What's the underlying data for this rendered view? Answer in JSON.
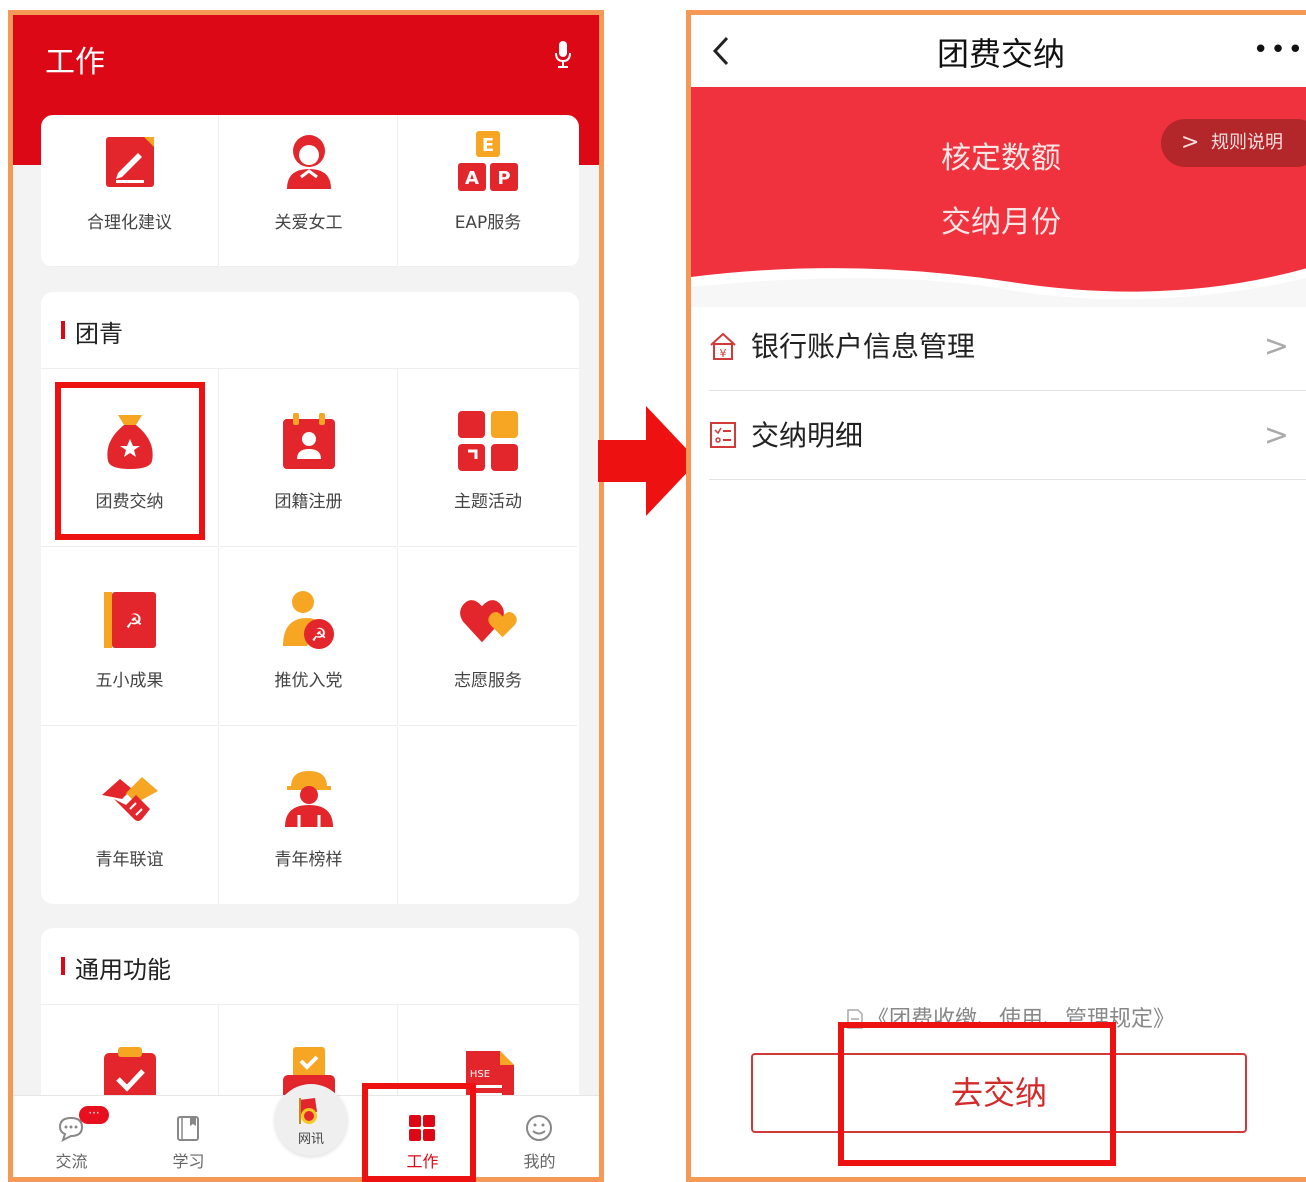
{
  "left_screen": {
    "header_title": "工作",
    "top_items": [
      {
        "label": "合理化建议",
        "icon": "edit-icon"
      },
      {
        "label": "关爱女工",
        "icon": "woman-worker-icon"
      },
      {
        "label": "EAP服务",
        "icon": "eap-icon"
      }
    ],
    "eap_letters": {
      "e": "E",
      "a": "A",
      "p": "P"
    },
    "section_tuanqing": {
      "title": "团青",
      "items": [
        {
          "label": "团费交纳",
          "icon": "money-bag-icon"
        },
        {
          "label": "团籍注册",
          "icon": "calendar-person-icon"
        },
        {
          "label": "主题活动",
          "icon": "theme-grid-icon"
        },
        {
          "label": "五小成果",
          "icon": "red-book-icon"
        },
        {
          "label": "推优入党",
          "icon": "party-person-icon"
        },
        {
          "label": "志愿服务",
          "icon": "heart-icon"
        },
        {
          "label": "青年联谊",
          "icon": "handshake-icon"
        },
        {
          "label": "青年榜样",
          "icon": "helmet-worker-icon"
        }
      ]
    },
    "section_general": {
      "title": "通用功能",
      "items": [
        {
          "icon": "checklist-icon"
        },
        {
          "icon": "approval-icon"
        },
        {
          "icon": "hse-document-icon",
          "text": "HSE"
        }
      ]
    },
    "tabbar": {
      "tabs": [
        {
          "label": "交流",
          "icon": "chat-icon",
          "badge": "···"
        },
        {
          "label": "学习",
          "icon": "book-icon"
        },
        {
          "label": "网讯",
          "icon": "league-badge-icon"
        },
        {
          "label": "工作",
          "icon": "grid-icon",
          "active": true
        },
        {
          "label": "我的",
          "icon": "smile-icon"
        }
      ]
    }
  },
  "right_screen": {
    "nav_title": "团费交纳",
    "more_label": "•••",
    "banner": {
      "line1": "核定数额",
      "line2": "交纳月份",
      "rule_label": "规则说明",
      "rule_chevron": ">"
    },
    "rows": [
      {
        "label": "银行账户信息管理",
        "icon": "bank-home-icon",
        "chevron": ">"
      },
      {
        "label": "交纳明细",
        "icon": "list-icon",
        "chevron": ">"
      }
    ],
    "regulation_link": "《团费收缴、使用、管理规定》",
    "pay_button": "去交纳"
  },
  "colors": {
    "primary_red": "#dc0815",
    "banner_red": "#f0323e",
    "highlight_box": "#ee1111",
    "arrow": "#ee1111",
    "frame_orange": "#f59a56"
  }
}
